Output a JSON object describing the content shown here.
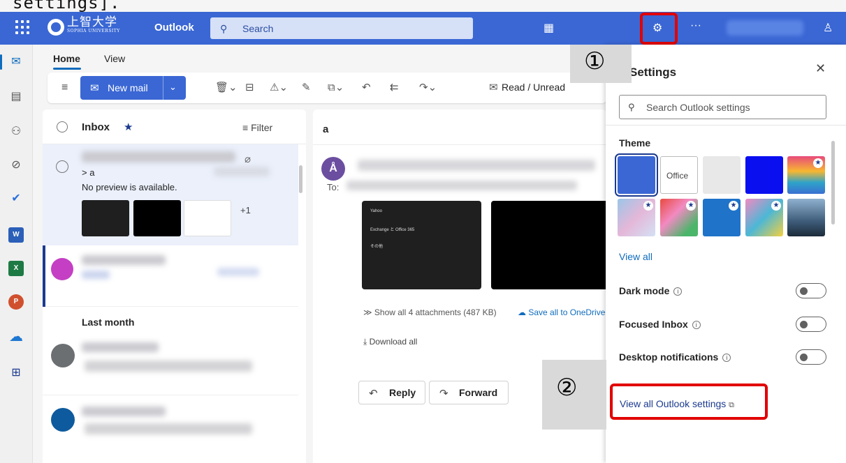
{
  "caption": "settings].",
  "topbar": {
    "logo_jp": "上智大学",
    "logo_en": "SOPHIA UNIVERSITY",
    "app_name": "Outlook",
    "search_placeholder": "Search",
    "more": "···"
  },
  "steps": {
    "one": "①",
    "two": "②"
  },
  "ribbon": {
    "tabs": [
      "Home",
      "View"
    ],
    "new_mail": "New mail",
    "read_unread": "Read / Unread"
  },
  "list": {
    "folder": "Inbox",
    "filter": "Filter",
    "msg1_subject": "> a",
    "msg1_preview": "No preview is available.",
    "msg1_more": "+1",
    "group_last_month": "Last month"
  },
  "reading": {
    "subject": "a",
    "to_label": "To:",
    "attachment_rows": [
      "Yahoo",
      "Exchange と Office 365",
      "その他"
    ],
    "show_all": "Show all 4 attachments (487 KB)",
    "save_all": "Save all to OneDrive",
    "download_all": "Download all",
    "reply": "Reply",
    "forward": "Forward"
  },
  "settings": {
    "title": "Settings",
    "search_placeholder": "Search Outlook settings",
    "theme_heading": "Theme",
    "office_tile": "Office",
    "view_all": "View all",
    "dark_mode": "Dark mode",
    "focused_inbox": "Focused Inbox",
    "desktop_notifications": "Desktop notifications",
    "view_all_settings": "View all Outlook settings"
  },
  "colors": {
    "brand": "#3a67d4",
    "highlight": "#e20000",
    "link": "#0f6cbd"
  }
}
